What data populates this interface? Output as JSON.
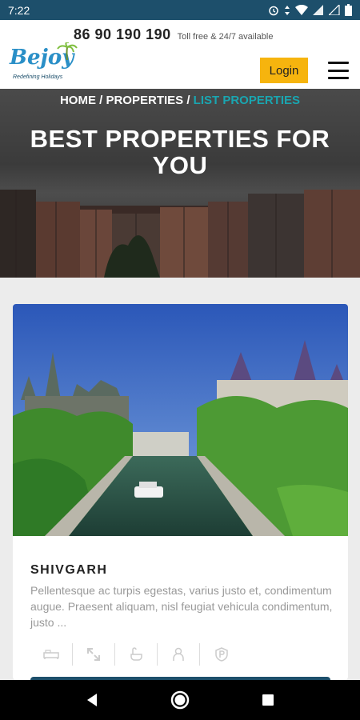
{
  "status_bar": {
    "time": "7:22"
  },
  "header": {
    "phone": "86 90 190 190",
    "phone_note": "Toll free & 24/7 available",
    "logo_text": "Bejoy",
    "logo_tagline": "Redefining Holidays",
    "login_label": "Login"
  },
  "hero": {
    "breadcrumb": [
      {
        "label": "HOME"
      },
      {
        "label": "PROPERTIES"
      },
      {
        "label": "LIST PROPERTIES"
      }
    ],
    "separator": "/",
    "title": "BEST PROPERTIES FOR YOU"
  },
  "property": {
    "name": "SHIVGARH",
    "description": "Pellentesque ac turpis egestas, varius justo et, condimentum augue. Praesent aliquam, nisl feugiat vehicula condimentum, justo ...",
    "amenities": [
      "bed-icon",
      "area-icon",
      "bath-icon",
      "person-icon",
      "parking-icon"
    ]
  },
  "colors": {
    "status_bar": "#1d4f6b",
    "accent": "#f6b40e",
    "breadcrumb_active": "#1aa5b0"
  }
}
